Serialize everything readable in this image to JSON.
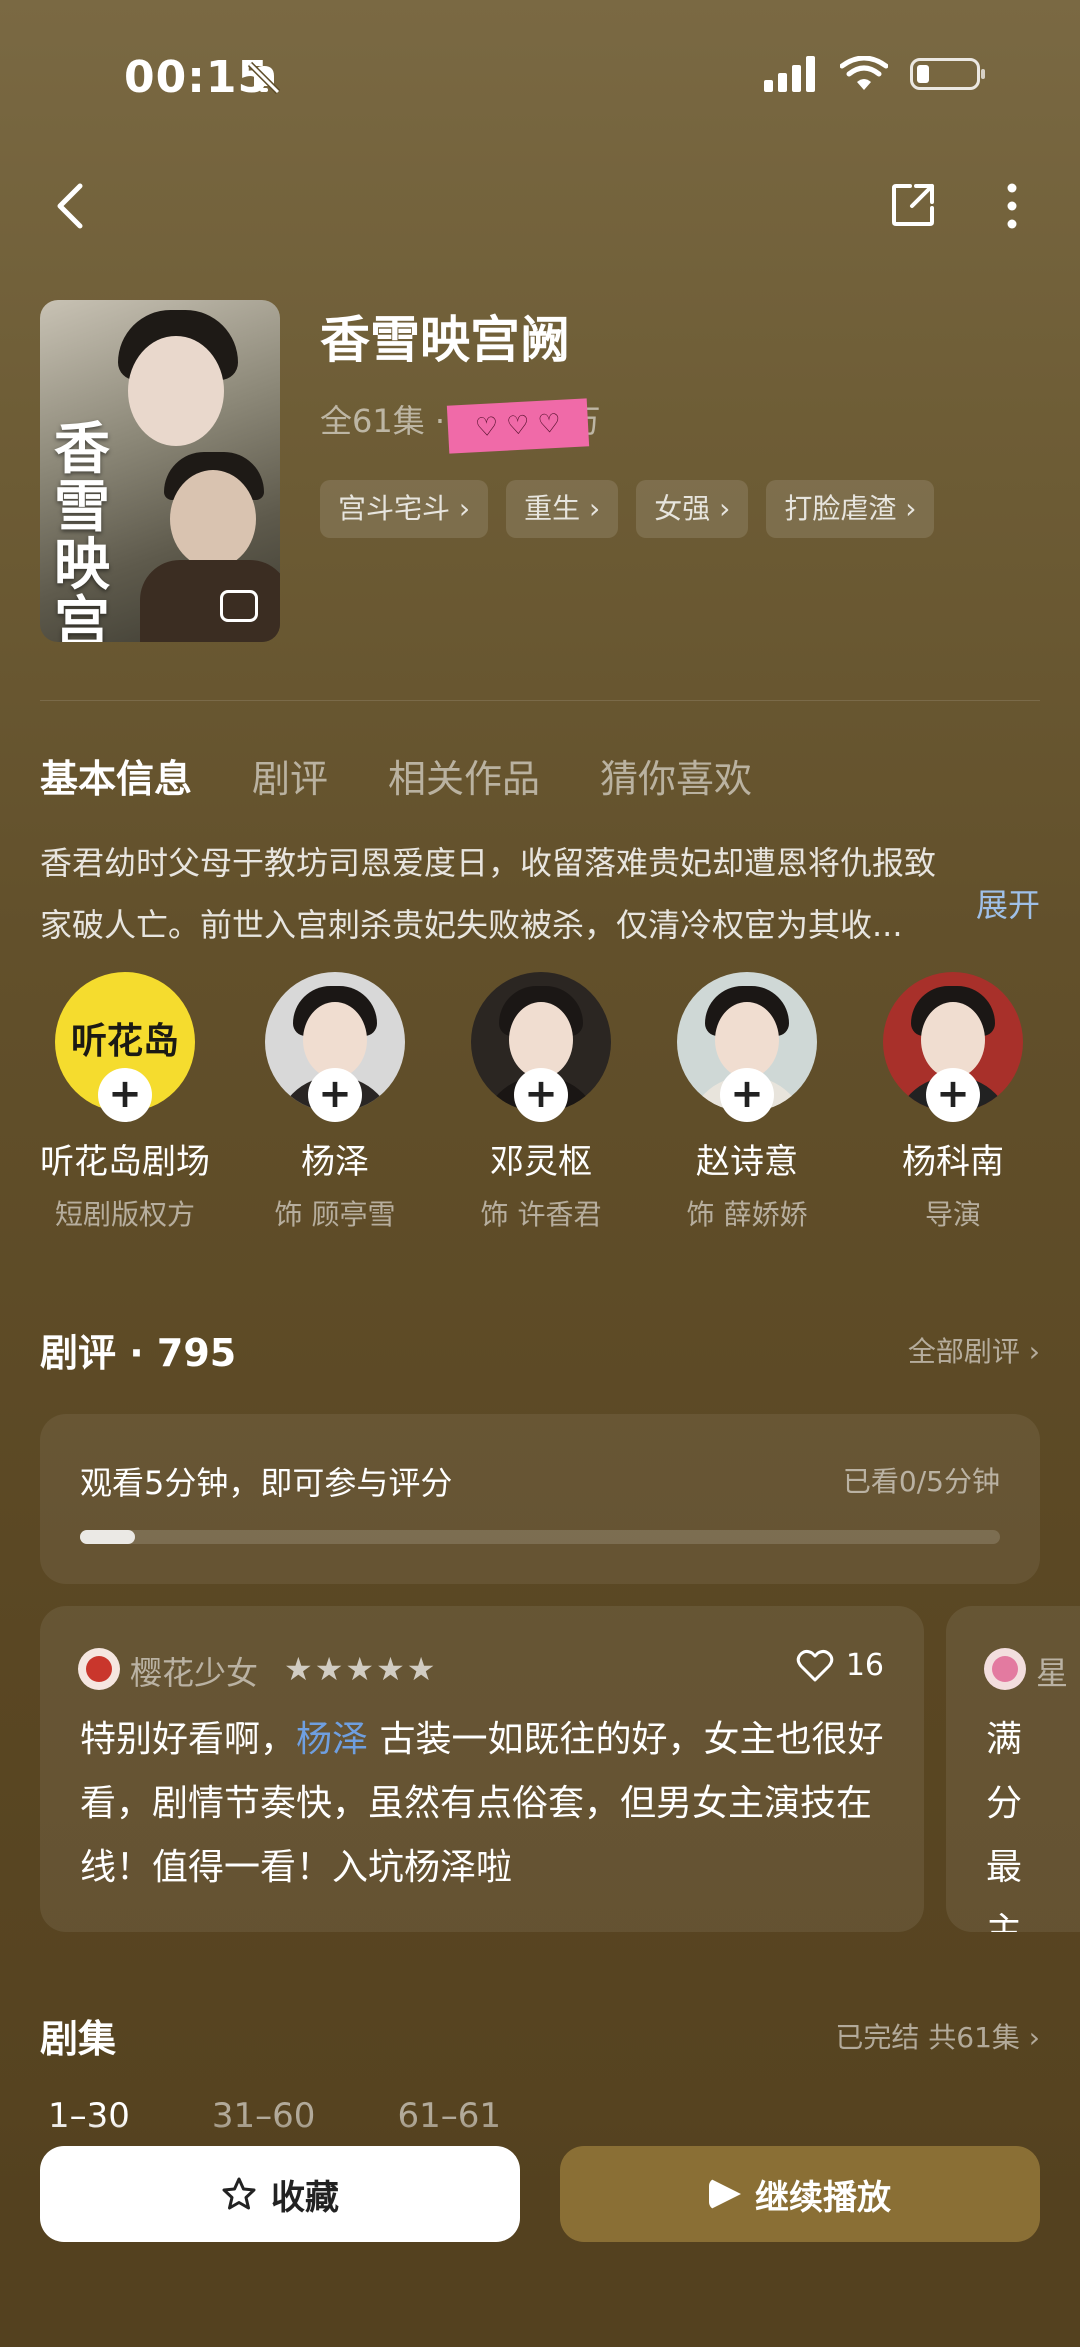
{
  "status": {
    "time": "00:15"
  },
  "drama": {
    "title": "香雪映宫阙",
    "meta": "全61集 · 值4144万",
    "poster_title": "香雪映宫阙",
    "tags": [
      "宫斗宅斗 ›",
      "重生 ›",
      "女强 ›",
      "打脸虐渣 ›"
    ]
  },
  "tabs": [
    "基本信息",
    "剧评",
    "相关作品",
    "猜你喜欢"
  ],
  "synopsis": {
    "text": "香君幼时父母于教坊司恩爱度日，收留落难贵妃却遭恩将仇报致家破人亡。前世入宫刺杀贵妃失败被杀，仅清冷权宦为其收...",
    "expand": "展开"
  },
  "people": [
    {
      "name": "听花岛剧场",
      "role": "短剧版权方",
      "logo": "听花岛"
    },
    {
      "name": "杨泽",
      "role": "饰 顾亭雪"
    },
    {
      "name": "邓灵枢",
      "role": "饰 许香君"
    },
    {
      "name": "赵诗意",
      "role": "饰 薛娇娇"
    },
    {
      "name": "杨科南",
      "role": "导演"
    }
  ],
  "reviews": {
    "title": "剧评 · 795",
    "all_link": "全部剧评 ›",
    "watch_prompt": "观看5分钟，即可参与评分",
    "watch_progress": "已看0/5分钟",
    "watch_fraction": 0.06,
    "items": [
      {
        "user": "樱花少女",
        "stars": "★★★★★",
        "likes": "16",
        "text_before": "特别好看啊，",
        "mention": "杨泽",
        "text_after": " 古装一如既往的好，女主也很好看，剧情节奏快，虽然有点俗套，但男女主演技在线！值得一看！入坑杨泽啦"
      },
      {
        "user": "星",
        "text": "满分最主话，"
      }
    ]
  },
  "episodes": {
    "title": "剧集",
    "status": "已完结 共61集 ›",
    "ranges": [
      "1–30",
      "31–60",
      "61–61"
    ]
  },
  "actions": {
    "collect": "收藏",
    "play": "继续播放"
  },
  "colors": {
    "accent_play": "#8a6f35",
    "link_blue": "#9fc0e8",
    "mention_blue": "#6f9fe0",
    "sticker_pink": "#f06aa8"
  }
}
